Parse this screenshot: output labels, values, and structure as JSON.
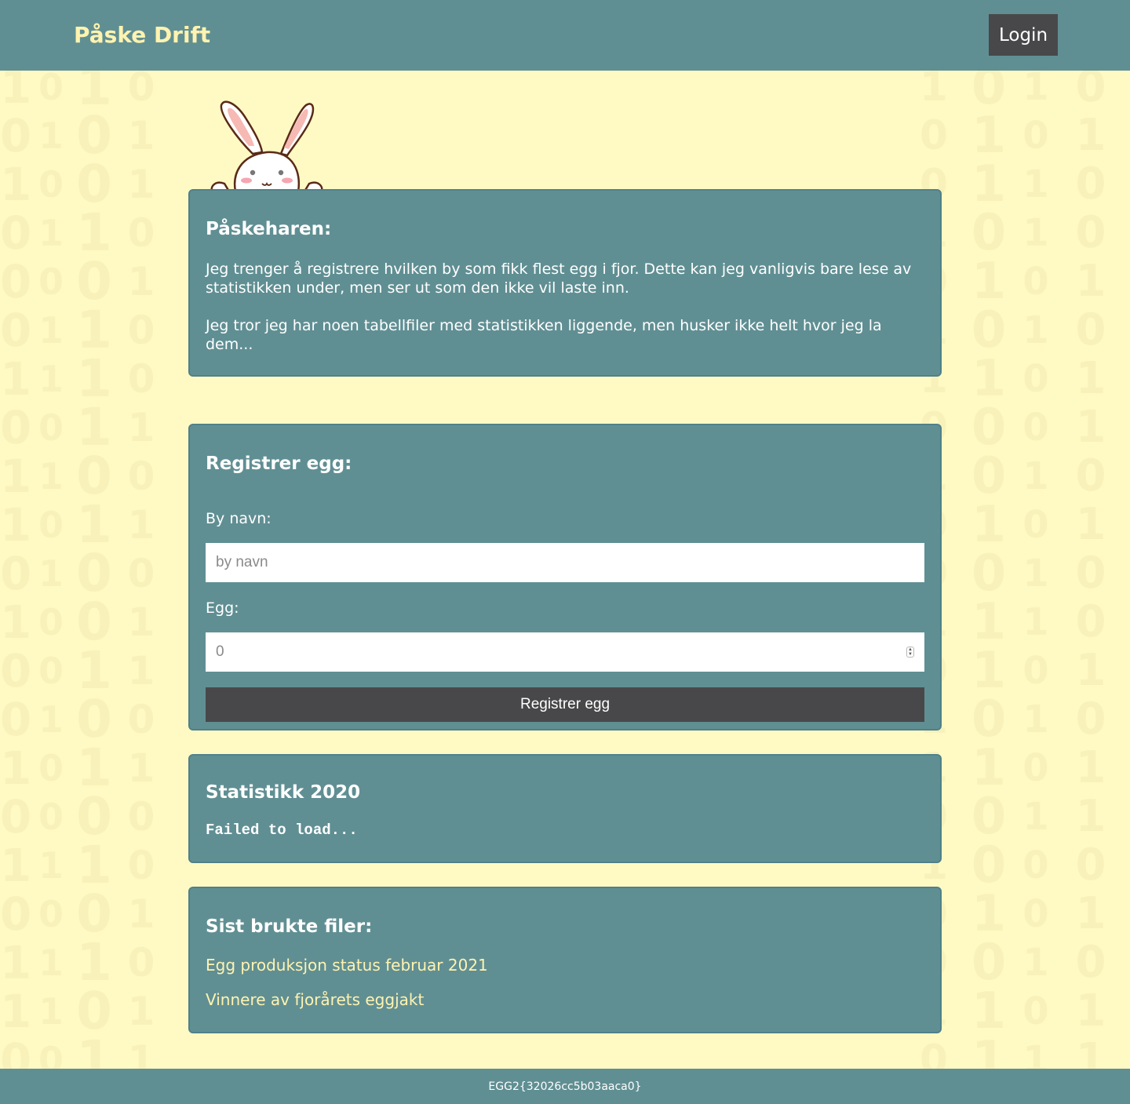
{
  "header": {
    "brand": "Påske Drift",
    "login_label": "Login"
  },
  "intro": {
    "title": "Påskeharen:",
    "paragraph_1": "Jeg trenger å registrere hvilken by som fikk flest egg i fjor. Dette kan jeg vanligvis bare lese av statistikken under, men ser ut som den ikke vil laste inn.",
    "paragraph_2": "Jeg tror jeg har noen tabellfiler med statistikken liggende, men husker ikke helt hvor jeg la dem..."
  },
  "register": {
    "title": "Registrer egg:",
    "city_label": "By navn:",
    "city_placeholder": "by navn",
    "city_value": "",
    "egg_label": "Egg:",
    "egg_value": "0",
    "submit_label": "Registrer egg"
  },
  "stats": {
    "title": "Statistikk 2020",
    "status": "Failed to load..."
  },
  "recent_files": {
    "title": "Sist brukte filer:",
    "files": [
      {
        "label": "Egg produksjon status februar 2021"
      },
      {
        "label": "Vinnere av fjorårets eggjakt"
      }
    ]
  },
  "footer": {
    "flag": "EGG2{32026cc5b03aaca0}"
  },
  "colors": {
    "background": "#fffac3",
    "header": "#608f93",
    "card": "#608f93",
    "brand": "#fff3b0",
    "button": "#48484a",
    "link": "#fff3b0"
  },
  "icons": {
    "mascot": "bunny-icon",
    "number_spinner": "spinner-icon"
  }
}
